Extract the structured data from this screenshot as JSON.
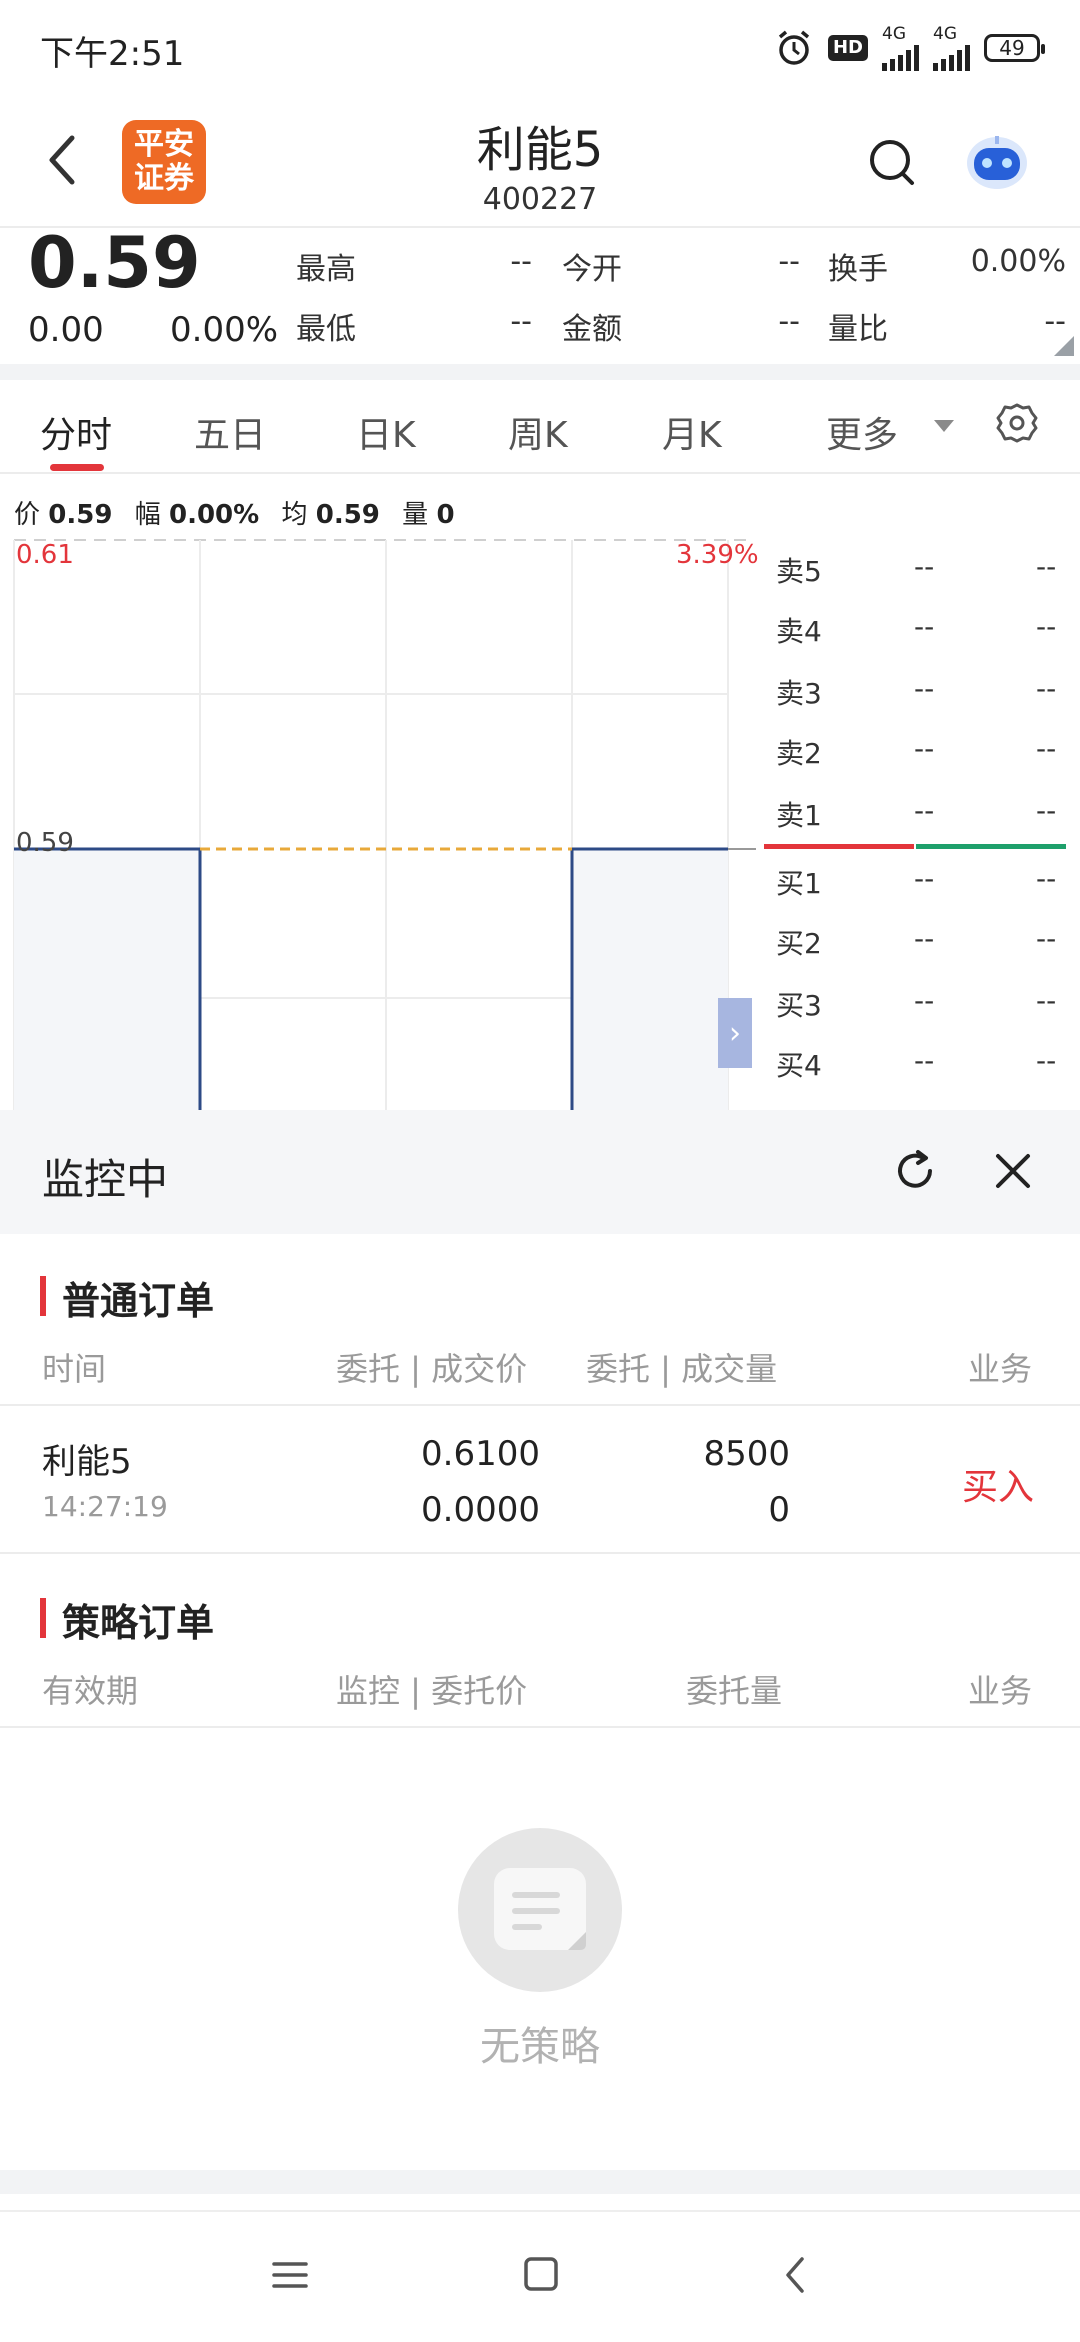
{
  "status_bar": {
    "time": "下午2:51",
    "hd": "HD",
    "net1": "4G",
    "net2": "4G",
    "battery": "49"
  },
  "header": {
    "logo_line1": "平安",
    "logo_line2": "证券",
    "stock_name": "利能5",
    "stock_code": "400227"
  },
  "quote": {
    "price": "0.59",
    "change": "0.00",
    "change_pct": "0.00%",
    "fields": [
      {
        "label": "最高",
        "value": "--"
      },
      {
        "label": "今开",
        "value": "--"
      },
      {
        "label": "换手",
        "value": "0.00%"
      },
      {
        "label": "最低",
        "value": "--"
      },
      {
        "label": "金额",
        "value": "--"
      },
      {
        "label": "量比",
        "value": "--"
      }
    ]
  },
  "tabs": [
    {
      "label": "分时",
      "active": true
    },
    {
      "label": "五日"
    },
    {
      "label": "日K"
    },
    {
      "label": "周K"
    },
    {
      "label": "月K"
    },
    {
      "label": "更多"
    }
  ],
  "info_row": {
    "price_label": "价",
    "price": "0.59",
    "range_label": "幅",
    "range": "0.00%",
    "avg_label": "均",
    "avg": "0.59",
    "vol_label": "量",
    "vol": "0"
  },
  "chart_data": {
    "type": "line",
    "top_left": "0.61",
    "top_right": "3.39%",
    "mid_label": "0.59",
    "series": [
      {
        "values": [
          0.59,
          0.59
        ]
      }
    ]
  },
  "order_book": {
    "asks": [
      {
        "label": "卖5",
        "price": "--",
        "vol": "--"
      },
      {
        "label": "卖4",
        "price": "--",
        "vol": "--"
      },
      {
        "label": "卖3",
        "price": "--",
        "vol": "--"
      },
      {
        "label": "卖2",
        "price": "--",
        "vol": "--"
      },
      {
        "label": "卖1",
        "price": "--",
        "vol": "--"
      }
    ],
    "bids": [
      {
        "label": "买1",
        "price": "--",
        "vol": "--"
      },
      {
        "label": "买2",
        "price": "--",
        "vol": "--"
      },
      {
        "label": "买3",
        "price": "--",
        "vol": "--"
      },
      {
        "label": "买4",
        "price": "--",
        "vol": "--"
      }
    ]
  },
  "monitor": {
    "title": "监控中",
    "normal_orders": {
      "title": "普通订单",
      "headers": [
        "时间",
        "委托 | 成交价",
        "委托 | 成交量",
        "业务"
      ],
      "rows": [
        {
          "name": "利能5",
          "time": "14:27:19",
          "order_price": "0.6100",
          "deal_price": "0.0000",
          "order_qty": "8500",
          "deal_qty": "0",
          "action": "买入"
        }
      ]
    },
    "strategy_orders": {
      "title": "策略订单",
      "headers": [
        "有效期",
        "监控 | 委托价",
        "委托量",
        "业务"
      ],
      "empty_text": "无策略"
    }
  },
  "colors": {
    "accent_red": "#e3353b",
    "accent_green": "#1ea06b",
    "logo_orange": "#ee6a25",
    "chart_line": "#2d4a86"
  }
}
